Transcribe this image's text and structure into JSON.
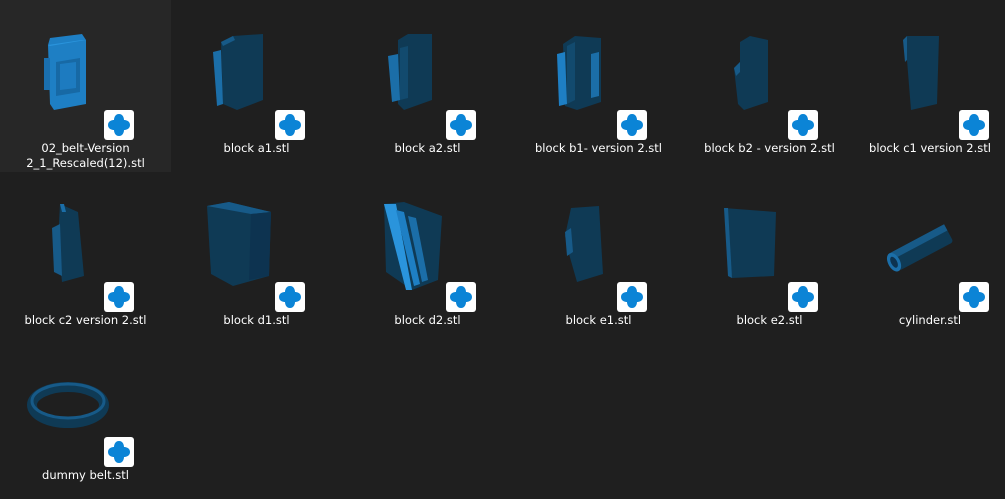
{
  "files": [
    {
      "name": "02_belt-Version 2_1_Rescaled(12).stl",
      "name_line1": "02_belt-Version",
      "name_line2": "2_1_Rescaled(12).stl",
      "shape": "belt-part-icon"
    },
    {
      "name": "block a1.stl",
      "shape": "block-model-icon"
    },
    {
      "name": "block a2.stl",
      "shape": "block-model-icon"
    },
    {
      "name": "block b1- version 2.stl",
      "shape": "block-model-icon"
    },
    {
      "name": "block b2 - version 2.stl",
      "shape": "block-model-icon"
    },
    {
      "name": "block c1 version 2.stl",
      "shape": "block-model-icon"
    },
    {
      "name": "block c2 version 2.stl",
      "shape": "block-model-icon"
    },
    {
      "name": "block d1.stl",
      "shape": "block-model-icon"
    },
    {
      "name": "block d2.stl",
      "shape": "block-model-icon"
    },
    {
      "name": "block e1.stl",
      "shape": "block-model-icon"
    },
    {
      "name": "block e2.stl",
      "shape": "block-model-icon"
    },
    {
      "name": "cylinder.stl",
      "shape": "cylinder-model-icon"
    },
    {
      "name": "dummy belt.stl",
      "shape": "ring-model-icon"
    }
  ],
  "colors": {
    "background": "#1f1f1f",
    "model_bright": "#1e7fc4",
    "model_dark": "#0f3a55",
    "badge_icon": "#0b84d6"
  },
  "badge_icon_name": "3d-viewer-app-icon"
}
